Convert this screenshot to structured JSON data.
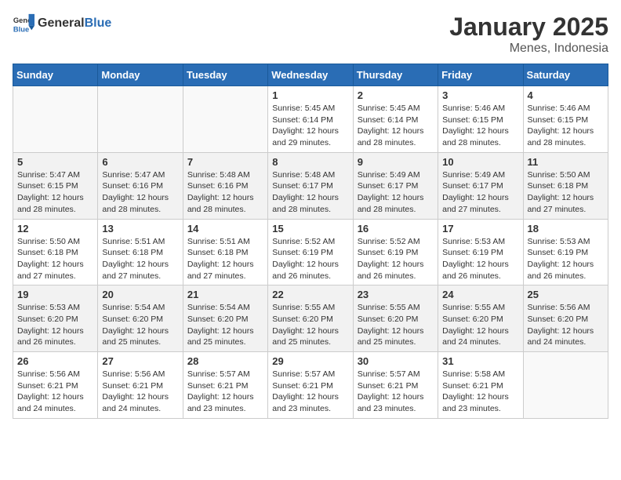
{
  "header": {
    "logo_general": "General",
    "logo_blue": "Blue",
    "title": "January 2025",
    "subtitle": "Menes, Indonesia"
  },
  "weekdays": [
    "Sunday",
    "Monday",
    "Tuesday",
    "Wednesday",
    "Thursday",
    "Friday",
    "Saturday"
  ],
  "weeks": [
    [
      {
        "day": "",
        "sunrise": "",
        "sunset": "",
        "daylight": ""
      },
      {
        "day": "",
        "sunrise": "",
        "sunset": "",
        "daylight": ""
      },
      {
        "day": "",
        "sunrise": "",
        "sunset": "",
        "daylight": ""
      },
      {
        "day": "1",
        "sunrise": "Sunrise: 5:45 AM",
        "sunset": "Sunset: 6:14 PM",
        "daylight": "Daylight: 12 hours and 29 minutes."
      },
      {
        "day": "2",
        "sunrise": "Sunrise: 5:45 AM",
        "sunset": "Sunset: 6:14 PM",
        "daylight": "Daylight: 12 hours and 28 minutes."
      },
      {
        "day": "3",
        "sunrise": "Sunrise: 5:46 AM",
        "sunset": "Sunset: 6:15 PM",
        "daylight": "Daylight: 12 hours and 28 minutes."
      },
      {
        "day": "4",
        "sunrise": "Sunrise: 5:46 AM",
        "sunset": "Sunset: 6:15 PM",
        "daylight": "Daylight: 12 hours and 28 minutes."
      }
    ],
    [
      {
        "day": "5",
        "sunrise": "Sunrise: 5:47 AM",
        "sunset": "Sunset: 6:15 PM",
        "daylight": "Daylight: 12 hours and 28 minutes."
      },
      {
        "day": "6",
        "sunrise": "Sunrise: 5:47 AM",
        "sunset": "Sunset: 6:16 PM",
        "daylight": "Daylight: 12 hours and 28 minutes."
      },
      {
        "day": "7",
        "sunrise": "Sunrise: 5:48 AM",
        "sunset": "Sunset: 6:16 PM",
        "daylight": "Daylight: 12 hours and 28 minutes."
      },
      {
        "day": "8",
        "sunrise": "Sunrise: 5:48 AM",
        "sunset": "Sunset: 6:17 PM",
        "daylight": "Daylight: 12 hours and 28 minutes."
      },
      {
        "day": "9",
        "sunrise": "Sunrise: 5:49 AM",
        "sunset": "Sunset: 6:17 PM",
        "daylight": "Daylight: 12 hours and 28 minutes."
      },
      {
        "day": "10",
        "sunrise": "Sunrise: 5:49 AM",
        "sunset": "Sunset: 6:17 PM",
        "daylight": "Daylight: 12 hours and 27 minutes."
      },
      {
        "day": "11",
        "sunrise": "Sunrise: 5:50 AM",
        "sunset": "Sunset: 6:18 PM",
        "daylight": "Daylight: 12 hours and 27 minutes."
      }
    ],
    [
      {
        "day": "12",
        "sunrise": "Sunrise: 5:50 AM",
        "sunset": "Sunset: 6:18 PM",
        "daylight": "Daylight: 12 hours and 27 minutes."
      },
      {
        "day": "13",
        "sunrise": "Sunrise: 5:51 AM",
        "sunset": "Sunset: 6:18 PM",
        "daylight": "Daylight: 12 hours and 27 minutes."
      },
      {
        "day": "14",
        "sunrise": "Sunrise: 5:51 AM",
        "sunset": "Sunset: 6:18 PM",
        "daylight": "Daylight: 12 hours and 27 minutes."
      },
      {
        "day": "15",
        "sunrise": "Sunrise: 5:52 AM",
        "sunset": "Sunset: 6:19 PM",
        "daylight": "Daylight: 12 hours and 26 minutes."
      },
      {
        "day": "16",
        "sunrise": "Sunrise: 5:52 AM",
        "sunset": "Sunset: 6:19 PM",
        "daylight": "Daylight: 12 hours and 26 minutes."
      },
      {
        "day": "17",
        "sunrise": "Sunrise: 5:53 AM",
        "sunset": "Sunset: 6:19 PM",
        "daylight": "Daylight: 12 hours and 26 minutes."
      },
      {
        "day": "18",
        "sunrise": "Sunrise: 5:53 AM",
        "sunset": "Sunset: 6:19 PM",
        "daylight": "Daylight: 12 hours and 26 minutes."
      }
    ],
    [
      {
        "day": "19",
        "sunrise": "Sunrise: 5:53 AM",
        "sunset": "Sunset: 6:20 PM",
        "daylight": "Daylight: 12 hours and 26 minutes."
      },
      {
        "day": "20",
        "sunrise": "Sunrise: 5:54 AM",
        "sunset": "Sunset: 6:20 PM",
        "daylight": "Daylight: 12 hours and 25 minutes."
      },
      {
        "day": "21",
        "sunrise": "Sunrise: 5:54 AM",
        "sunset": "Sunset: 6:20 PM",
        "daylight": "Daylight: 12 hours and 25 minutes."
      },
      {
        "day": "22",
        "sunrise": "Sunrise: 5:55 AM",
        "sunset": "Sunset: 6:20 PM",
        "daylight": "Daylight: 12 hours and 25 minutes."
      },
      {
        "day": "23",
        "sunrise": "Sunrise: 5:55 AM",
        "sunset": "Sunset: 6:20 PM",
        "daylight": "Daylight: 12 hours and 25 minutes."
      },
      {
        "day": "24",
        "sunrise": "Sunrise: 5:55 AM",
        "sunset": "Sunset: 6:20 PM",
        "daylight": "Daylight: 12 hours and 24 minutes."
      },
      {
        "day": "25",
        "sunrise": "Sunrise: 5:56 AM",
        "sunset": "Sunset: 6:20 PM",
        "daylight": "Daylight: 12 hours and 24 minutes."
      }
    ],
    [
      {
        "day": "26",
        "sunrise": "Sunrise: 5:56 AM",
        "sunset": "Sunset: 6:21 PM",
        "daylight": "Daylight: 12 hours and 24 minutes."
      },
      {
        "day": "27",
        "sunrise": "Sunrise: 5:56 AM",
        "sunset": "Sunset: 6:21 PM",
        "daylight": "Daylight: 12 hours and 24 minutes."
      },
      {
        "day": "28",
        "sunrise": "Sunrise: 5:57 AM",
        "sunset": "Sunset: 6:21 PM",
        "daylight": "Daylight: 12 hours and 23 minutes."
      },
      {
        "day": "29",
        "sunrise": "Sunrise: 5:57 AM",
        "sunset": "Sunset: 6:21 PM",
        "daylight": "Daylight: 12 hours and 23 minutes."
      },
      {
        "day": "30",
        "sunrise": "Sunrise: 5:57 AM",
        "sunset": "Sunset: 6:21 PM",
        "daylight": "Daylight: 12 hours and 23 minutes."
      },
      {
        "day": "31",
        "sunrise": "Sunrise: 5:58 AM",
        "sunset": "Sunset: 6:21 PM",
        "daylight": "Daylight: 12 hours and 23 minutes."
      },
      {
        "day": "",
        "sunrise": "",
        "sunset": "",
        "daylight": ""
      }
    ]
  ]
}
